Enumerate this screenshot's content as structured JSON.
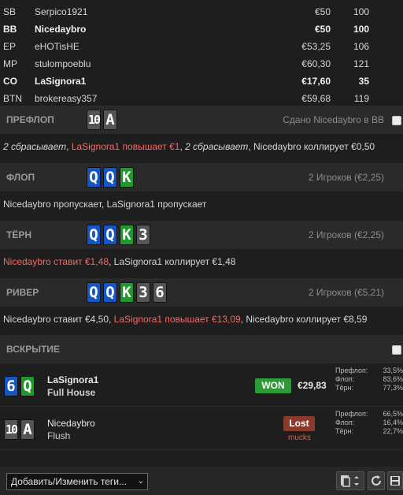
{
  "players": [
    {
      "pos": "SB",
      "name": "Serpico1921",
      "stack": "€50",
      "bb": "100",
      "bold": false
    },
    {
      "pos": "BB",
      "name": "Nicedaybro",
      "stack": "€50",
      "bb": "100",
      "bold": true
    },
    {
      "pos": "EP",
      "name": "eHOTisHE",
      "stack": "€53,25",
      "bb": "106",
      "bold": false
    },
    {
      "pos": "MP",
      "name": "stulompoeblu",
      "stack": "€60,30",
      "bb": "121",
      "bold": false
    },
    {
      "pos": "CO",
      "name": "LaSignora1",
      "stack": "€17,60",
      "bb": "35",
      "bold": true
    },
    {
      "pos": "BTN",
      "name": "brokereasy357",
      "stack": "€59,68",
      "bb": "119",
      "bold": false
    }
  ],
  "preflop": {
    "title": "ПРЕФЛОП",
    "info": "Сдано Nicedaybro в BB",
    "actions": [
      {
        "text": "2 сбрасывает",
        "style": "italic"
      },
      {
        "text": ", ",
        "style": "plain"
      },
      {
        "text": "LaSignora1 повышает €1",
        "style": "red"
      },
      {
        "text": ", ",
        "style": "plain"
      },
      {
        "text": "2 сбрасывает",
        "style": "italic"
      },
      {
        "text": ", Nicedaybro коллирует €0,50",
        "style": "plain"
      }
    ]
  },
  "flop": {
    "title": "ФЛОП",
    "info": "2 Игроков (€2,25)",
    "actions": [
      {
        "text": "Nicedaybro пропускает, LaSignora1 пропускает",
        "style": "plain"
      }
    ]
  },
  "turn": {
    "title": "ТЁРН",
    "info": "2 Игроков (€2,25)",
    "actions": [
      {
        "text": "Nicedaybro ставит €1,48",
        "style": "red"
      },
      {
        "text": ", LaSignora1 коллирует €1,48",
        "style": "plain"
      }
    ]
  },
  "river": {
    "title": "РИВЕР",
    "info": "2 Игроков (€5,21)",
    "actions": [
      {
        "text": "Nicedaybro ставит €4,50, ",
        "style": "plain"
      },
      {
        "text": "LaSignora1 повышает €13,09",
        "style": "red"
      },
      {
        "text": ", Nicedaybro коллирует €8,59",
        "style": "plain"
      }
    ]
  },
  "showdown_title": "ВСКРЫТИЕ",
  "cards": {
    "hero": [
      {
        "rank": "10",
        "color": "gray"
      },
      {
        "rank": "A",
        "color": "gray"
      }
    ],
    "flop": [
      {
        "rank": "Q",
        "color": "blue"
      },
      {
        "rank": "Q",
        "color": "blue"
      },
      {
        "rank": "K",
        "color": "green"
      }
    ],
    "turn": [
      {
        "rank": "Q",
        "color": "blue"
      },
      {
        "rank": "Q",
        "color": "blue"
      },
      {
        "rank": "K",
        "color": "green"
      },
      {
        "rank": "3",
        "color": "gray"
      }
    ],
    "river": [
      {
        "rank": "Q",
        "color": "blue"
      },
      {
        "rank": "Q",
        "color": "blue"
      },
      {
        "rank": "K",
        "color": "green"
      },
      {
        "rank": "3",
        "color": "gray"
      },
      {
        "rank": "6",
        "color": "gray"
      }
    ],
    "winner": [
      {
        "rank": "6",
        "color": "blue"
      },
      {
        "rank": "Q",
        "color": "teal"
      }
    ],
    "loser": [
      {
        "rank": "10",
        "color": "gray"
      },
      {
        "rank": "A",
        "color": "gray"
      }
    ]
  },
  "showdown": {
    "winner": {
      "name": "LaSignora1",
      "hand": "Full House",
      "result": "WON",
      "amount": "€29,83",
      "equity": [
        {
          "label": "Префлоп:",
          "value": "33,5%"
        },
        {
          "label": "Флоп:",
          "value": "83,6%"
        },
        {
          "label": "Тёрн:",
          "value": "77,3%"
        }
      ]
    },
    "loser": {
      "name": "Nicedaybro",
      "hand": "Flush",
      "result": "Lost",
      "note": "mucks",
      "equity": [
        {
          "label": "Префлоп:",
          "value": "66,5%"
        },
        {
          "label": "Флоп:",
          "value": "16,4%"
        },
        {
          "label": "Тёрн:",
          "value": "22,7%"
        }
      ]
    }
  },
  "bottom": {
    "tags_label": "Добавить/Изменить теги...",
    "icons": [
      "clipboard-icon",
      "refresh-icon",
      "save-icon"
    ]
  },
  "colors": {
    "background": "#1e1e1e",
    "street_header": "#2a2a2a",
    "action_red": "#f06a6a",
    "won": "#2e9a36",
    "lost": "#8a3a2c",
    "card_blue": "#1456c4",
    "card_green": "#1e9a2c",
    "card_gray": "#555555"
  }
}
